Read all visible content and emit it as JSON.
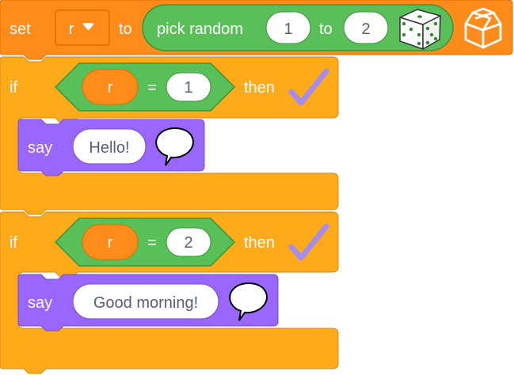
{
  "set_block": {
    "keyword": "set",
    "variable": "r",
    "to_label": "to",
    "pick_random": {
      "label": "pick random",
      "from_value": "1",
      "to_label": "to",
      "to_value": "2",
      "icon": "dice-icon"
    },
    "extension_icon": "open-box-icon"
  },
  "if_blocks": [
    {
      "keyword": "if",
      "condition": {
        "variable": "r",
        "operator": "=",
        "value": "1"
      },
      "then_label": "then",
      "check_icon": "checkmark-icon",
      "say": {
        "keyword": "say",
        "message": "Hello!",
        "icon": "speech-bubble-icon"
      }
    },
    {
      "keyword": "if",
      "condition": {
        "variable": "r",
        "operator": "=",
        "value": "2"
      },
      "then_label": "then",
      "check_icon": "checkmark-icon",
      "say": {
        "keyword": "say",
        "message": "Good morning!",
        "icon": "speech-bubble-icon"
      }
    }
  ],
  "colors": {
    "data_block": "#ff8c1a",
    "data_block_border": "#db6e00",
    "control_block": "#ffab19",
    "control_block_border": "#cf8b17",
    "operator_block": "#59c059",
    "operator_block_border": "#389438",
    "looks_block": "#9966ff",
    "looks_block_border": "#774dcb",
    "input_text": "#575e75"
  }
}
